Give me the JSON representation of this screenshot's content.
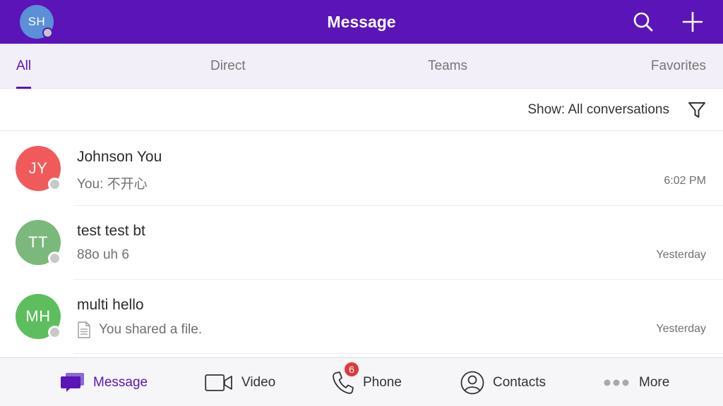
{
  "header": {
    "title": "Message",
    "avatar_initials": "SH",
    "avatar_color": "#5b8fd6",
    "brand_color": "#5a14b8",
    "icons": {
      "search": "search-icon",
      "add": "plus-icon"
    }
  },
  "tabs": [
    {
      "label": "All",
      "active": true
    },
    {
      "label": "Direct",
      "active": false
    },
    {
      "label": "Teams",
      "active": false
    },
    {
      "label": "Favorites",
      "active": false
    }
  ],
  "filter": {
    "label": "Show: All conversations",
    "icon": "filter-icon"
  },
  "conversations": [
    {
      "initials": "JY",
      "avatar_color": "#f15a5b",
      "name": "Johnson You",
      "preview": "You: 不开心",
      "time": "6:02 PM",
      "has_file_icon": false
    },
    {
      "initials": "TT",
      "avatar_color": "#7bb87b",
      "name": "test test bt",
      "preview": "88o uh 6",
      "time": "Yesterday",
      "has_file_icon": false
    },
    {
      "initials": "MH",
      "avatar_color": "#5cbe5c",
      "name": "multi hello",
      "preview": "You shared a file.",
      "time": "Yesterday",
      "has_file_icon": true
    }
  ],
  "bottom_nav": [
    {
      "label": "Message",
      "icon": "message-icon",
      "active": true,
      "badge": ""
    },
    {
      "label": "Video",
      "icon": "video-icon",
      "active": false,
      "badge": ""
    },
    {
      "label": "Phone",
      "icon": "phone-icon",
      "active": false,
      "badge": "6"
    },
    {
      "label": "Contacts",
      "icon": "contacts-icon",
      "active": false,
      "badge": ""
    },
    {
      "label": "More",
      "icon": "more-icon",
      "active": false,
      "badge": ""
    }
  ]
}
